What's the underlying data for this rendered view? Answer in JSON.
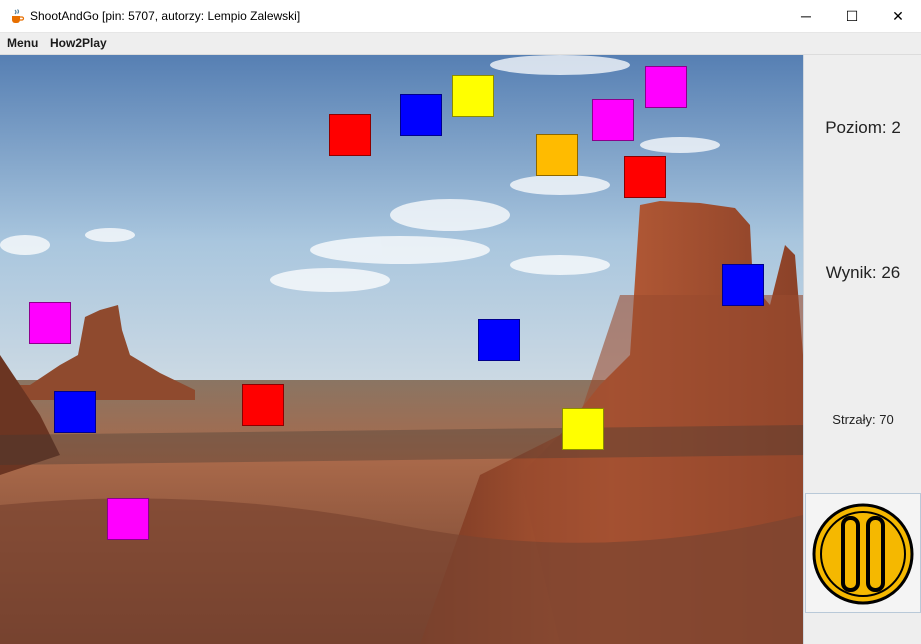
{
  "window": {
    "title": "ShootAndGo [pin: 5707, autorzy: Lempio Zalewski]",
    "app_icon": "java-cup-icon",
    "controls": {
      "minimize": "─",
      "maximize": "☐",
      "close": "✕"
    }
  },
  "menubar": {
    "items": [
      {
        "label": "Menu"
      },
      {
        "label": "How2Play"
      }
    ]
  },
  "game": {
    "background": "desert-mesa-landscape",
    "targets": [
      {
        "color": "#ff00ff"
      },
      {
        "color": "#ffff00"
      },
      {
        "color": "#0000ff"
      },
      {
        "color": "#ff00ff"
      },
      {
        "color": "#ff0000"
      },
      {
        "color": "#ffbb00"
      },
      {
        "color": "#ff0000"
      },
      {
        "color": "#0000ff"
      },
      {
        "color": "#ff00ff"
      },
      {
        "color": "#0000ff"
      },
      {
        "color": "#ff0000"
      },
      {
        "color": "#0000ff"
      },
      {
        "color": "#ffff00"
      },
      {
        "color": "#ff00ff"
      }
    ]
  },
  "side_panel": {
    "level_text": "Poziom: 2",
    "score_text": "Wynik: 26",
    "shots_text": "Strzały: 70",
    "pause_button": {
      "icon": "pause-icon",
      "accent": "#f5b800"
    }
  }
}
